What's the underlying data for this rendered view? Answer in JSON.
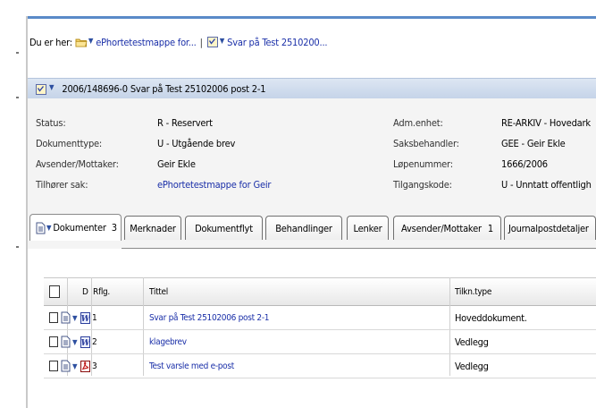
{
  "breadcrumb": {
    "prefix": "Du er her:",
    "items": [
      {
        "label": "ePhortetestmappe for...",
        "icon": "folder-icon"
      },
      {
        "label": "Svar på Test 2510200...",
        "icon": "document-icon"
      }
    ],
    "separator": "|"
  },
  "document": {
    "title": "2006/148696-0  Svar på Test 25102006 post 2-1"
  },
  "meta": {
    "left": [
      {
        "label": "Status:",
        "value": "R - Reservert"
      },
      {
        "label": "Dokumenttype:",
        "value": "U - Utgående brev"
      },
      {
        "label": "Avsender/Mottaker:",
        "value": "Geir Ekle"
      },
      {
        "label": "Tilhører sak:",
        "value": "ePhortetestmappe for Geir"
      }
    ],
    "right": [
      {
        "label": "Adm.enhet:",
        "value": "RE-ARKIV - Hovedark"
      },
      {
        "label": "Saksbehandler:",
        "value": "GEE - Geir Ekle"
      },
      {
        "label": "Løpenummer:",
        "value": "1666/2006"
      },
      {
        "label": "Tilgangskode:",
        "value": "U - Unntatt offentligh"
      }
    ]
  },
  "tabs": [
    {
      "label": "Dokumenter",
      "count": "3",
      "active": true
    },
    {
      "label": "Merknader"
    },
    {
      "label": "Dokumentflyt"
    },
    {
      "label": "Behandlinger"
    },
    {
      "label": "Lenker"
    },
    {
      "label": "Avsender/Mottaker",
      "count": "1"
    },
    {
      "label": "Journalpostdetaljer"
    }
  ],
  "table": {
    "headers": {
      "d": "D",
      "rflg": "Rflg.",
      "tittel": "Tittel",
      "tilkn": "Tilkn.type"
    },
    "rows": [
      {
        "nr": "1",
        "title": "Svar på Test 25102006 post 2-1",
        "type": "Hoveddokument.",
        "file_icon": "word-icon"
      },
      {
        "nr": "2",
        "title": "klagebrev",
        "type": "Vedlegg",
        "file_icon": "word-icon"
      },
      {
        "nr": "3",
        "title": "Test varsle med e-post",
        "type": "Vedlegg",
        "file_icon": "pdf-icon"
      }
    ]
  },
  "colors": {
    "link": "#1a2fa8",
    "header_bar": "#c4d3e8",
    "panel_bg": "#f4f4f4"
  }
}
